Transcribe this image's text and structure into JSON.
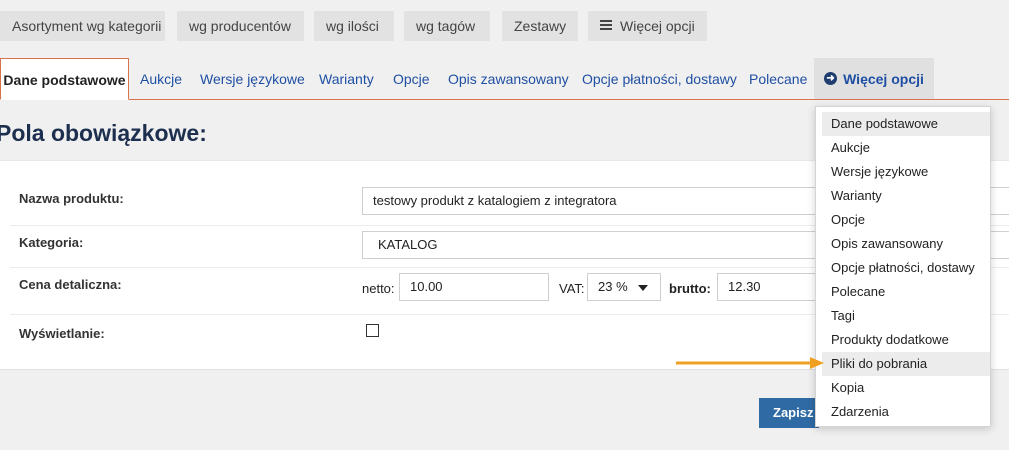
{
  "topbar": {
    "buttons": [
      "Asortyment wg kategorii",
      "wg producentów",
      "wg ilości",
      "wg tagów",
      "Zestawy",
      "Więcej opcji"
    ]
  },
  "tabs": [
    "Dane podstawowe",
    "Aukcje",
    "Wersje językowe",
    "Warianty",
    "Opcje",
    "Opis zawansowany",
    "Opcje płatności, dostawy",
    "Polecane",
    "Więcej opcji"
  ],
  "section_title": "Pola obowiązkowe:",
  "form": {
    "name_label": "Nazwa produktu:",
    "name_value": "testowy produkt z katalogiem z integratora",
    "category_label": "Kategoria:",
    "category_value": "KATALOG",
    "price_label": "Cena detaliczna:",
    "netto_label": "netto:",
    "netto_value": "10.00",
    "vat_label": "VAT:",
    "vat_value": "23 %",
    "brutto_label": "brutto:",
    "brutto_value": "12.30",
    "display_label": "Wyświetlanie:",
    "display_checked": false
  },
  "save_label": "Zapisz",
  "dropdown": {
    "items": [
      "Dane podstawowe",
      "Aukcje",
      "Wersje językowe",
      "Warianty",
      "Opcje",
      "Opis zawansowany",
      "Opcje płatności, dostawy",
      "Polecane",
      "Tagi",
      "Produkty dodatkowe",
      "Pliki do pobrania",
      "Kopia",
      "Zdarzenia"
    ],
    "highlighted": [
      "Dane podstawowe",
      "Pliki do pobrania"
    ]
  },
  "colors": {
    "tab_link": "#1f4fa3",
    "tab_border": "#d9734e",
    "save_button": "#2f6aa5",
    "annotation_arrow": "#f0a020"
  }
}
